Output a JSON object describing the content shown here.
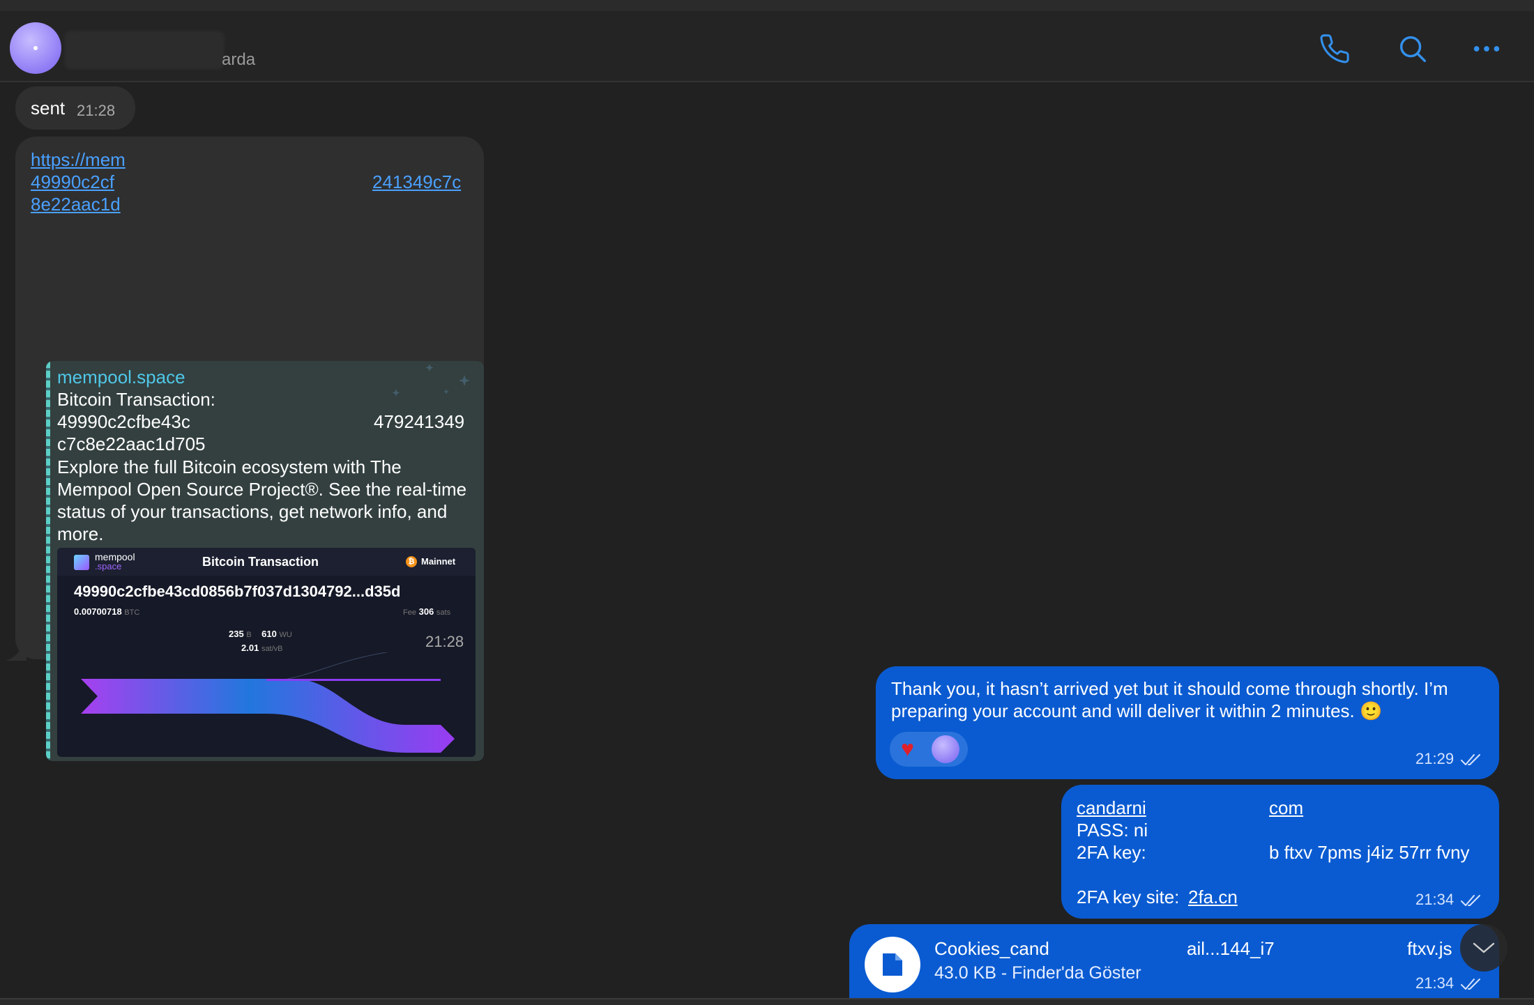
{
  "header": {
    "status_suffix": "arda",
    "call_icon": "phone-icon",
    "search_icon": "search-icon",
    "more_icon": "more-icon"
  },
  "messages": {
    "sent_msg": {
      "text": "sent",
      "time": "21:28"
    },
    "link_msg": {
      "link_line1": "https://mem",
      "link_line2_left": "49990c2cf",
      "link_line2_right": "241349c7c",
      "link_line3": "8e22aac1d",
      "preview": {
        "site": "mempool.space",
        "title": "Bitcoin Transaction:",
        "hash_line1_left": "49990c2cfbe43c",
        "hash_line1_right": "479241349",
        "hash_line2": "c7c8e22aac1d705",
        "description": "Explore the full Bitcoin ecosystem with The Mempool Open Source Project®. See the real-time status of your transactions, get network info, and more.",
        "card": {
          "logo_top": "mempool",
          "logo_bottom": ".space",
          "card_title": "Bitcoin Transaction",
          "network": "Mainnet",
          "txid": "49990c2cfbe43cd0856b7f037d1304792...d35d",
          "amount": "0.00700718",
          "amount_unit": "BTC",
          "fee_label": "Fee",
          "fee_value": "306",
          "fee_unit": "sats",
          "size_value": "235",
          "size_unit": "B",
          "weight_value": "610",
          "weight_unit": "WU",
          "rate_value": "2.01",
          "rate_unit": "sat/vB"
        }
      },
      "time": "21:28"
    },
    "out_msg1": {
      "text": "Thank you, it hasn’t arrived yet but it should come through shortly. I’m preparing your account and will deliver it within 2 minutes. 🙂",
      "reaction": "♥",
      "time": "21:29"
    },
    "out_msg2": {
      "email_left": "candarni",
      "email_right": "com",
      "pass_label": "PASS: ni",
      "twofa_label": "2FA key:",
      "twofa_value": "b ftxv 7pms j4iz 57rr fvny",
      "site_label": "2FA key site: ",
      "site_link": "2fa.cn",
      "time": "21:34"
    },
    "file_msg": {
      "name_left": "Cookies_cand",
      "name_mid": "ail...144_i7",
      "name_right": "ftxv.js",
      "meta": "43.0 KB - Finder'da Göster",
      "time": "21:34"
    }
  },
  "colors": {
    "outgoing": "#0a5bd1",
    "incoming": "#2f2f2f",
    "accent": "#3390ec"
  }
}
